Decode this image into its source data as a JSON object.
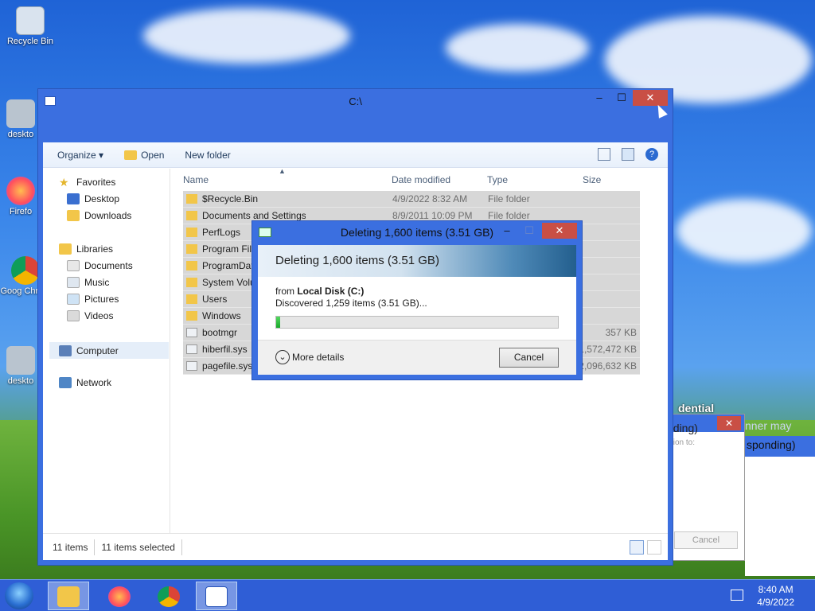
{
  "desktop": {
    "icons": [
      {
        "label": "Recycle Bin"
      },
      {
        "label": "deskto"
      },
      {
        "label": "Firefo"
      },
      {
        "label": "Goog Chrom"
      },
      {
        "label": "deskto"
      }
    ]
  },
  "explorer": {
    "title": "C:\\",
    "toolbar": {
      "organize": "Organize ▾",
      "open": "Open",
      "new_folder": "New folder"
    },
    "nav": {
      "favorites": "Favorites",
      "desktop": "Desktop",
      "downloads": "Downloads",
      "libraries": "Libraries",
      "documents": "Documents",
      "music": "Music",
      "pictures": "Pictures",
      "videos": "Videos",
      "computer": "Computer",
      "network": "Network"
    },
    "columns": {
      "name": "Name",
      "date": "Date modified",
      "type": "Type",
      "size": "Size"
    },
    "files": [
      {
        "name": "$Recycle.Bin",
        "date": "4/9/2022 8:32 AM",
        "type": "File folder",
        "size": ""
      },
      {
        "name": "Documents and Settings",
        "date": "8/9/2011 10:09 PM",
        "type": "File folder",
        "size": ""
      },
      {
        "name": "PerfLogs",
        "date": "",
        "type": "",
        "size": ""
      },
      {
        "name": "Program File",
        "date": "",
        "type": "",
        "size": ""
      },
      {
        "name": "ProgramDat",
        "date": "",
        "type": "",
        "size": ""
      },
      {
        "name": "System Volu",
        "date": "",
        "type": "",
        "size": ""
      },
      {
        "name": "Users",
        "date": "",
        "type": "",
        "size": ""
      },
      {
        "name": "Windows",
        "date": "",
        "type": "",
        "size": ""
      },
      {
        "name": "bootmgr",
        "date": "",
        "type": "",
        "size": "357 KB"
      },
      {
        "name": "hiberfil.sys",
        "date": "",
        "type": "",
        "size": "1,572,472 KB"
      },
      {
        "name": "pagefile.sys",
        "date": "",
        "type": "",
        "size": "2,096,632 KB"
      }
    ],
    "status": {
      "count": "11 items",
      "selected": "11 items selected"
    }
  },
  "dialog": {
    "title": "Deleting 1,600 items (3.51 GB)",
    "banner": "Deleting 1,600 items (3.51 GB)",
    "from_prefix": "from",
    "from_location": "Local Disk (C:)",
    "discovered": "Discovered 1,259 items (3.51 GB)...",
    "progress_percent": 1.5,
    "more_details": "More details",
    "cancel": "Cancel"
  },
  "background_window": {
    "title_fragment": "dential",
    "not_responding_1": "nding)",
    "not_responding_2": "sponding)",
    "runner_fragment": "nner may",
    "action_fragment": "tion to:",
    "cancel": "Cancel"
  },
  "taskbar": {
    "time": "8:40 AM",
    "date": "4/9/2022"
  }
}
